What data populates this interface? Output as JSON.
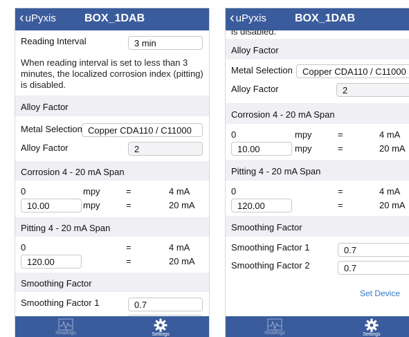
{
  "nav": {
    "back_label": "uPyxis",
    "title": "BOX_1DAB"
  },
  "tabs": {
    "readings": "Readings",
    "settings": "Settings"
  },
  "reading_interval": {
    "label": "Reading Interval",
    "value": "3 min"
  },
  "note": {
    "line1": "When reading interval is set to less than 3",
    "line2": "minutes, the localized corrosion index (pitting)",
    "line3": "is disabled.",
    "cut": "is disabled."
  },
  "alloy": {
    "header": "Alloy Factor",
    "metal_label": "Metal Selection",
    "metal_value": "Copper CDA110 / C11000",
    "factor_label": "Alloy Factor",
    "factor_value": "2"
  },
  "corrosion": {
    "header": "Corrosion 4 - 20 mA Span",
    "low": "0",
    "high": "10.00",
    "unit": "mpy",
    "eq": "=",
    "ma_low": "4 mA",
    "ma_high": "20 mA"
  },
  "pitting": {
    "header": "Pitting 4 - 20 mA Span",
    "low": "0",
    "high": "120.00",
    "eq": "=",
    "ma_low": "4 mA",
    "ma_high": "20 mA"
  },
  "smoothing": {
    "header": "Smoothing Factor",
    "f1_label": "Smoothing Factor 1",
    "f1_value": "0.7",
    "f2_label": "Smoothing Factor 2",
    "f2_value": "0.7"
  },
  "set_device": "Set Device"
}
